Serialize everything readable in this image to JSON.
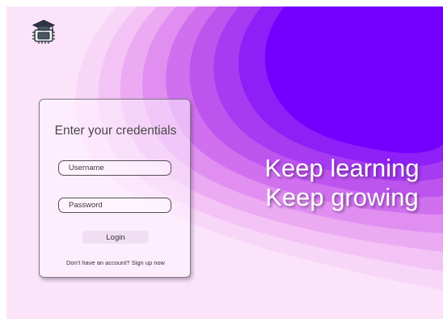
{
  "brand": {
    "logo_icon": "graduation-cap-chip-icon"
  },
  "login_card": {
    "title": "Enter your credentials",
    "username_placeholder": "Username",
    "password_placeholder": "Password",
    "login_label": "Login",
    "signup_prompt": "Don't have an account?",
    "signup_link": "Sign up now"
  },
  "tagline": {
    "line1": "Keep learning",
    "line2": "Keep growing"
  },
  "colors": {
    "background": "#fbe4fa",
    "wave_darkest": "#7300ff",
    "wave_lightest": "#f7cdf7",
    "text_light": "#ffffff"
  }
}
